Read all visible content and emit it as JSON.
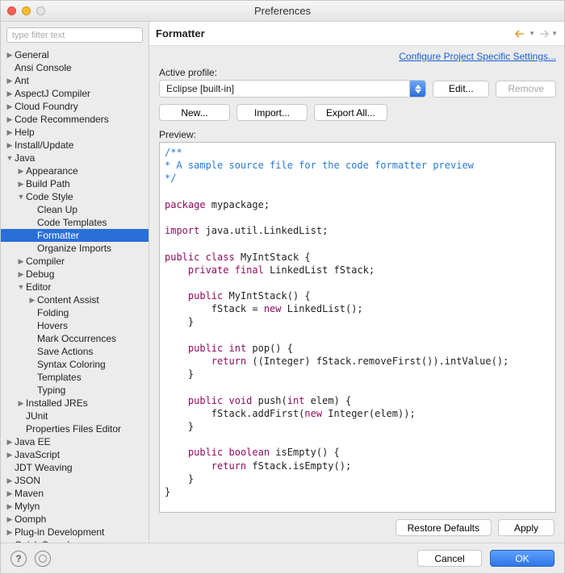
{
  "window": {
    "title": "Preferences"
  },
  "sidebar": {
    "filter_placeholder": "type filter text",
    "items": [
      {
        "label": "General",
        "depth": 0,
        "arrow": "right"
      },
      {
        "label": "Ansi Console",
        "depth": 0,
        "arrow": ""
      },
      {
        "label": "Ant",
        "depth": 0,
        "arrow": "right"
      },
      {
        "label": "AspectJ Compiler",
        "depth": 0,
        "arrow": "right"
      },
      {
        "label": "Cloud Foundry",
        "depth": 0,
        "arrow": "right"
      },
      {
        "label": "Code Recommenders",
        "depth": 0,
        "arrow": "right"
      },
      {
        "label": "Help",
        "depth": 0,
        "arrow": "right"
      },
      {
        "label": "Install/Update",
        "depth": 0,
        "arrow": "right"
      },
      {
        "label": "Java",
        "depth": 0,
        "arrow": "down"
      },
      {
        "label": "Appearance",
        "depth": 1,
        "arrow": "right"
      },
      {
        "label": "Build Path",
        "depth": 1,
        "arrow": "right"
      },
      {
        "label": "Code Style",
        "depth": 1,
        "arrow": "down"
      },
      {
        "label": "Clean Up",
        "depth": 2,
        "arrow": ""
      },
      {
        "label": "Code Templates",
        "depth": 2,
        "arrow": ""
      },
      {
        "label": "Formatter",
        "depth": 2,
        "arrow": "",
        "selected": true
      },
      {
        "label": "Organize Imports",
        "depth": 2,
        "arrow": ""
      },
      {
        "label": "Compiler",
        "depth": 1,
        "arrow": "right"
      },
      {
        "label": "Debug",
        "depth": 1,
        "arrow": "right"
      },
      {
        "label": "Editor",
        "depth": 1,
        "arrow": "down"
      },
      {
        "label": "Content Assist",
        "depth": 2,
        "arrow": "right"
      },
      {
        "label": "Folding",
        "depth": 2,
        "arrow": ""
      },
      {
        "label": "Hovers",
        "depth": 2,
        "arrow": ""
      },
      {
        "label": "Mark Occurrences",
        "depth": 2,
        "arrow": ""
      },
      {
        "label": "Save Actions",
        "depth": 2,
        "arrow": ""
      },
      {
        "label": "Syntax Coloring",
        "depth": 2,
        "arrow": ""
      },
      {
        "label": "Templates",
        "depth": 2,
        "arrow": ""
      },
      {
        "label": "Typing",
        "depth": 2,
        "arrow": ""
      },
      {
        "label": "Installed JREs",
        "depth": 1,
        "arrow": "right"
      },
      {
        "label": "JUnit",
        "depth": 1,
        "arrow": ""
      },
      {
        "label": "Properties Files Editor",
        "depth": 1,
        "arrow": ""
      },
      {
        "label": "Java EE",
        "depth": 0,
        "arrow": "right"
      },
      {
        "label": "JavaScript",
        "depth": 0,
        "arrow": "right"
      },
      {
        "label": "JDT Weaving",
        "depth": 0,
        "arrow": ""
      },
      {
        "label": "JSON",
        "depth": 0,
        "arrow": "right"
      },
      {
        "label": "Maven",
        "depth": 0,
        "arrow": "right"
      },
      {
        "label": "Mylyn",
        "depth": 0,
        "arrow": "right"
      },
      {
        "label": "Oomph",
        "depth": 0,
        "arrow": "right"
      },
      {
        "label": "Plug-in Development",
        "depth": 0,
        "arrow": "right"
      },
      {
        "label": "Quick Search",
        "depth": 0,
        "arrow": ""
      }
    ]
  },
  "header": {
    "title": "Formatter"
  },
  "configure_link": "Configure Project Specific Settings...",
  "profile": {
    "label": "Active profile:",
    "value": "Eclipse [built-in]",
    "edit": "Edit...",
    "remove": "Remove"
  },
  "actions": {
    "new": "New...",
    "import": "Import...",
    "export": "Export All..."
  },
  "preview": {
    "label": "Preview:",
    "tokens": [
      {
        "t": "/**",
        "c": "c-comment"
      },
      {
        "t": "\n"
      },
      {
        "t": "* A sample source file for the code formatter preview",
        "c": "c-comment"
      },
      {
        "t": "\n"
      },
      {
        "t": "*/",
        "c": "c-comment"
      },
      {
        "t": "\n\n"
      },
      {
        "t": "package",
        "c": "c-kw"
      },
      {
        "t": " mypackage;"
      },
      {
        "t": "\n\n"
      },
      {
        "t": "import",
        "c": "c-kw"
      },
      {
        "t": " java.util.LinkedList;"
      },
      {
        "t": "\n\n"
      },
      {
        "t": "public",
        "c": "c-kw"
      },
      {
        "t": " "
      },
      {
        "t": "class",
        "c": "c-kw"
      },
      {
        "t": " MyIntStack {"
      },
      {
        "t": "\n"
      },
      {
        "t": "    "
      },
      {
        "t": "private",
        "c": "c-kw"
      },
      {
        "t": " "
      },
      {
        "t": "final",
        "c": "c-kw"
      },
      {
        "t": " LinkedList fStack;"
      },
      {
        "t": "\n\n"
      },
      {
        "t": "    "
      },
      {
        "t": "public",
        "c": "c-kw"
      },
      {
        "t": " MyIntStack() {"
      },
      {
        "t": "\n"
      },
      {
        "t": "        fStack = "
      },
      {
        "t": "new",
        "c": "c-kw"
      },
      {
        "t": " LinkedList();"
      },
      {
        "t": "\n"
      },
      {
        "t": "    }"
      },
      {
        "t": "\n\n"
      },
      {
        "t": "    "
      },
      {
        "t": "public",
        "c": "c-kw"
      },
      {
        "t": " "
      },
      {
        "t": "int",
        "c": "c-kw"
      },
      {
        "t": " pop() {"
      },
      {
        "t": "\n"
      },
      {
        "t": "        "
      },
      {
        "t": "return",
        "c": "c-kw"
      },
      {
        "t": " ((Integer) fStack.removeFirst()).intValue();"
      },
      {
        "t": "\n"
      },
      {
        "t": "    }"
      },
      {
        "t": "\n\n"
      },
      {
        "t": "    "
      },
      {
        "t": "public",
        "c": "c-kw"
      },
      {
        "t": " "
      },
      {
        "t": "void",
        "c": "c-kw"
      },
      {
        "t": " push("
      },
      {
        "t": "int",
        "c": "c-kw"
      },
      {
        "t": " elem) {"
      },
      {
        "t": "\n"
      },
      {
        "t": "        fStack.addFirst("
      },
      {
        "t": "new",
        "c": "c-kw"
      },
      {
        "t": " Integer(elem));"
      },
      {
        "t": "\n"
      },
      {
        "t": "    }"
      },
      {
        "t": "\n\n"
      },
      {
        "t": "    "
      },
      {
        "t": "public",
        "c": "c-kw"
      },
      {
        "t": " "
      },
      {
        "t": "boolean",
        "c": "c-kw"
      },
      {
        "t": " isEmpty() {"
      },
      {
        "t": "\n"
      },
      {
        "t": "        "
      },
      {
        "t": "return",
        "c": "c-kw"
      },
      {
        "t": " fStack.isEmpty();"
      },
      {
        "t": "\n"
      },
      {
        "t": "    }"
      },
      {
        "t": "\n"
      },
      {
        "t": "}"
      }
    ]
  },
  "bottom": {
    "restore": "Restore Defaults",
    "apply": "Apply"
  },
  "footer": {
    "cancel": "Cancel",
    "ok": "OK"
  }
}
